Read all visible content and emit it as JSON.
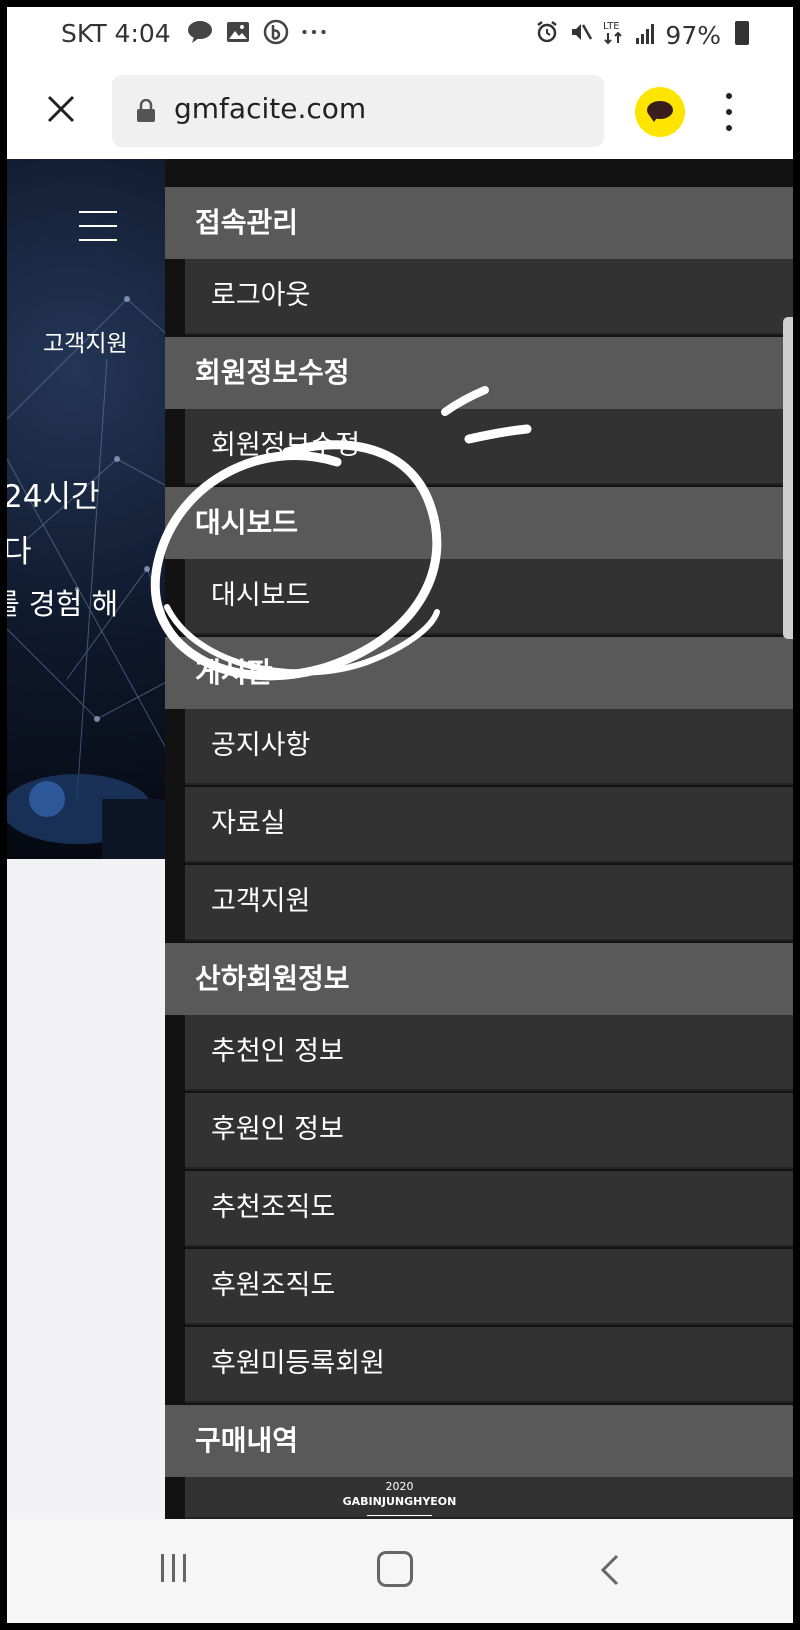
{
  "status_bar": {
    "carrier_time": "SKT 4:04",
    "notification_icons": [
      "talk-icon",
      "image-icon",
      "b-app-icon",
      "more-dots-icon"
    ],
    "battery": "97%",
    "network": "LTE"
  },
  "browser": {
    "url": "gmfacite.com",
    "accent_color": "#fee500"
  },
  "background_page": {
    "support_link": "고객지원",
    "hero_line1": "24시간",
    "hero_line2": "다",
    "hero_line3": "를 경험 해"
  },
  "menu": {
    "sections": [
      {
        "title": "접속관리",
        "items": [
          "로그아웃"
        ]
      },
      {
        "title": "회원정보수정",
        "items": [
          "회원정보수정"
        ]
      },
      {
        "title": "대시보드",
        "items": [
          "대시보드"
        ]
      },
      {
        "title": "게시판",
        "items": [
          "공지사항",
          "자료실",
          "고객지원"
        ]
      },
      {
        "title": "산하회원정보",
        "items": [
          "추천인 정보",
          "후원인 정보",
          "추천조직도",
          "후원조직도",
          "후원미등록회원"
        ]
      },
      {
        "title": "구매내역",
        "items": []
      }
    ]
  },
  "watermark": {
    "year": "2020",
    "name": "GABINJUNGHYEON"
  },
  "colors": {
    "section_header": "#595959",
    "menu_item": "#323232",
    "menu_bg": "#121212"
  }
}
